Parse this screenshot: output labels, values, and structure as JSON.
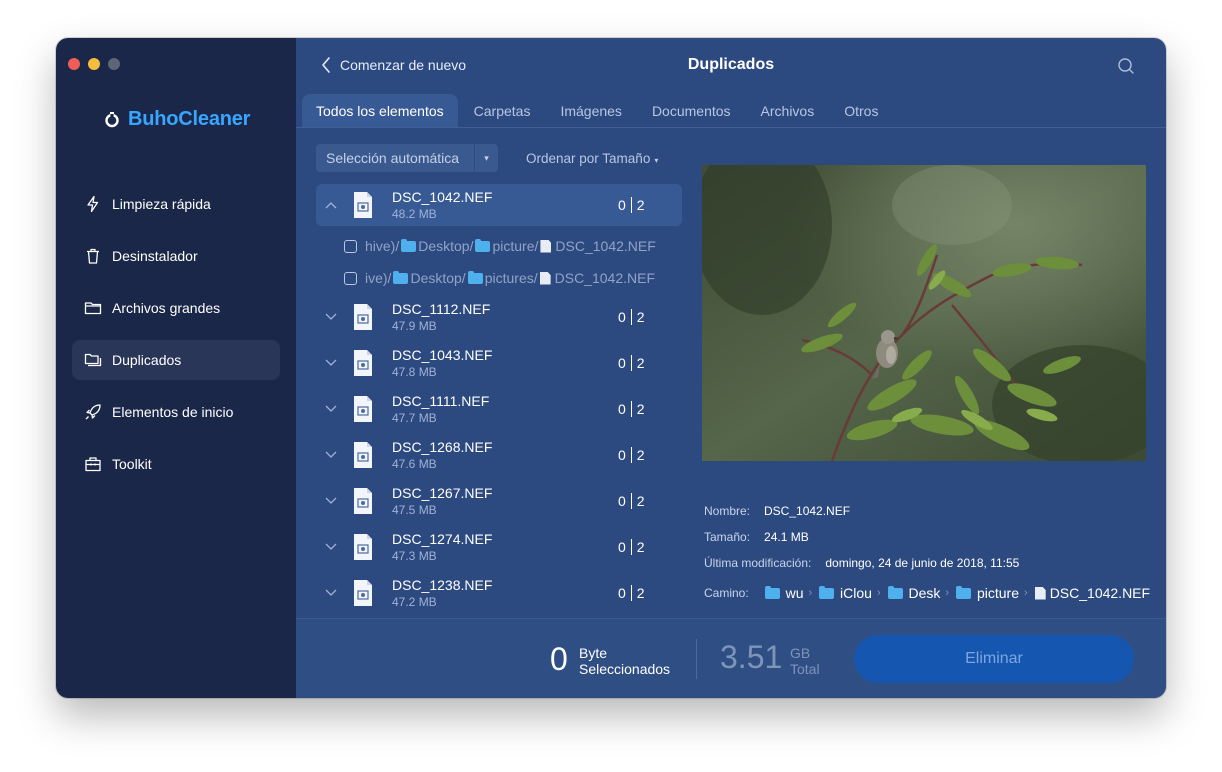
{
  "sidebar": {
    "brand": "BuhoCleaner",
    "items": [
      {
        "label": "Limpieza rápida",
        "icon": "lightning-icon"
      },
      {
        "label": "Desinstalador",
        "icon": "trash-icon"
      },
      {
        "label": "Archivos grandes",
        "icon": "folder-icon"
      },
      {
        "label": "Duplicados",
        "icon": "duplicate-folder-icon",
        "active": true
      },
      {
        "label": "Elementos de inicio",
        "icon": "rocket-icon"
      },
      {
        "label": "Toolkit",
        "icon": "toolkit-icon"
      }
    ]
  },
  "header": {
    "back_label": "Comenzar de nuevo",
    "title": "Duplicados"
  },
  "tabs": [
    "Todos los elementos",
    "Carpetas",
    "Imágenes",
    "Documentos",
    "Archivos",
    "Otros"
  ],
  "toolbar": {
    "select_label": "Selección automática",
    "sort_label": "Ordenar por Tamaño"
  },
  "groups": [
    {
      "name": "DSC_1042.NEF",
      "size": "48.2 MB",
      "selected": "0",
      "total": "2",
      "expanded": true,
      "paths": [
        {
          "p1": "hive)/",
          "p2": "Desktop/",
          "p3": "picture/",
          "file": "DSC_1042.NEF"
        },
        {
          "p1": "ive)/",
          "p2": "Desktop/",
          "p3": "pictures/",
          "file": "DSC_1042.NEF"
        }
      ]
    },
    {
      "name": "DSC_1112.NEF",
      "size": "47.9 MB",
      "selected": "0",
      "total": "2"
    },
    {
      "name": "DSC_1043.NEF",
      "size": "47.8 MB",
      "selected": "0",
      "total": "2"
    },
    {
      "name": "DSC_1111.NEF",
      "size": "47.7 MB",
      "selected": "0",
      "total": "2"
    },
    {
      "name": "DSC_1268.NEF",
      "size": "47.6 MB",
      "selected": "0",
      "total": "2"
    },
    {
      "name": "DSC_1267.NEF",
      "size": "47.5 MB",
      "selected": "0",
      "total": "2"
    },
    {
      "name": "DSC_1274.NEF",
      "size": "47.3 MB",
      "selected": "0",
      "total": "2"
    },
    {
      "name": "DSC_1238.NEF",
      "size": "47.2 MB",
      "selected": "0",
      "total": "2"
    }
  ],
  "details": {
    "name_label": "Nombre:",
    "name_value": "DSC_1042.NEF",
    "size_label": "Tamaño:",
    "size_value": "24.1 MB",
    "modified_label": "Última modificación:",
    "modified_value": "domingo, 24 de junio de 2018, 11:55",
    "path_label": "Camino:",
    "path": [
      "wu",
      "iClou",
      "Desk",
      "picture",
      "DSC_1042.NEF"
    ]
  },
  "footer": {
    "selected_value": "0",
    "selected_unit": "Byte",
    "selected_label": "Seleccionados",
    "total_value": "3.51",
    "total_unit": "GB",
    "total_label": "Total",
    "delete_label": "Eliminar"
  },
  "colors": {
    "sidebar_bg": "#1b2748",
    "main_bg": "#2d4a80",
    "brand": "#38a6ff",
    "button": "#1557b0"
  }
}
